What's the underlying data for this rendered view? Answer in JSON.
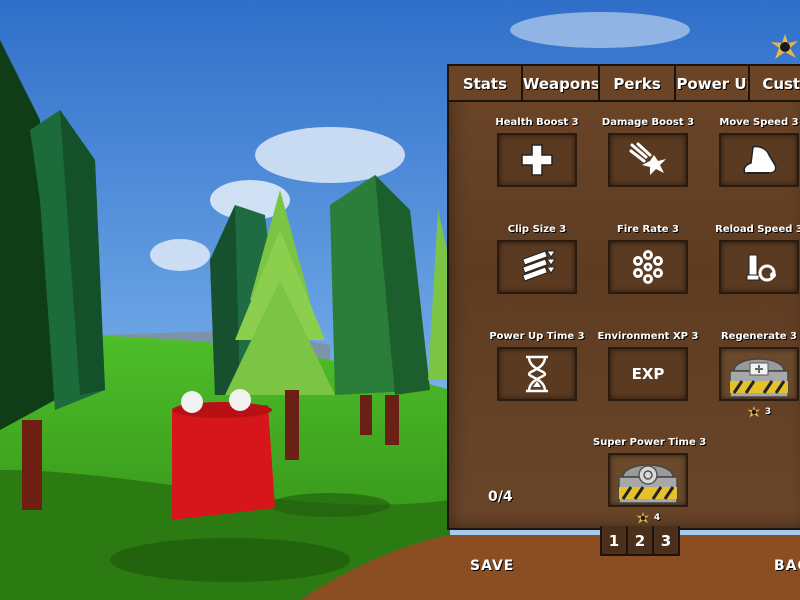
{
  "tabs": [
    "Stats",
    "Weapons",
    "Perks",
    "Power Ups",
    "Cust"
  ],
  "perks": [
    {
      "label": "Health Boost 3",
      "icon": "health-cross-icon"
    },
    {
      "label": "Damage Boost 3",
      "icon": "damage-boost-icon"
    },
    {
      "label": "Move Speed 3",
      "icon": "boot-icon"
    },
    {
      "label": "Clip Size 3",
      "icon": "bullets-icon"
    },
    {
      "label": "Fire Rate 3",
      "icon": "revolver-cylinder-icon"
    },
    {
      "label": "Reload Speed 3",
      "icon": "reload-shell-icon"
    },
    {
      "label": "Power Up Time 3",
      "icon": "hourglass-icon"
    },
    {
      "label": "Environment XP 3",
      "icon_text": "EXP"
    },
    {
      "label": "Regenerate 3",
      "icon": "locked-chest-icon",
      "cost": "3"
    },
    {
      "label": "Super Power Time 3",
      "icon": "locked-chest-icon",
      "cost": "4"
    }
  ],
  "counter": "0/4",
  "pages": [
    "1",
    "2",
    "3"
  ],
  "save_label": "SAVE",
  "back_label": "BAC"
}
